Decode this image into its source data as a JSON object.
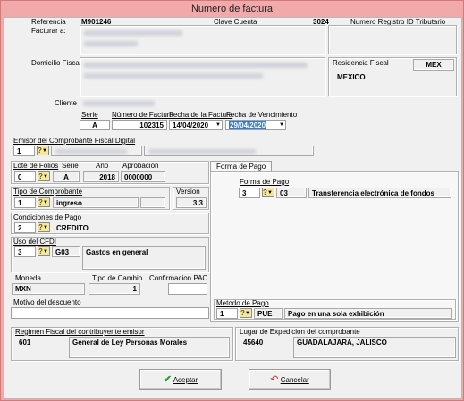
{
  "window": {
    "title": "Numero de factura"
  },
  "header": {
    "referencia_label": "Referencia",
    "referencia_value": "M901246",
    "clave_cuenta_label": "Clave Cuenta",
    "clave_cuenta_value": "3024",
    "numero_registro_label": "Numero Registro ID Tributario",
    "facturar_a_label": "Facturar a:",
    "domicilio_fiscal_label": "Domicilio Fiscal",
    "residencia_fiscal_label": "Residencia Fiscal",
    "residencia_code": "MEX",
    "residencia_name": "MEXICO",
    "cliente_label": "Cliente"
  },
  "invoice": {
    "serie_label": "Serie",
    "serie_value": "A",
    "numero_label": "Número de Factura",
    "numero_value": "102315",
    "fecha_label": "Fecha de la Factura",
    "fecha_value": "14/04/2020",
    "vencimiento_label": "Fecha de Vencimiento",
    "vencimiento_value": "29/04/2020"
  },
  "emisor": {
    "label": "Emisor del Comprobante Fiscal Digital",
    "value": "1"
  },
  "folios": {
    "lote_label": "Lote de Folios",
    "lote_value": "0",
    "serie_label": "Serie",
    "serie_value": "A",
    "anio_label": "Año",
    "anio_value": "2018",
    "aprobacion_label": "Aprobación",
    "aprobacion_value": "0000000"
  },
  "comprobante": {
    "tipo_label": "Tipo de Comprobante",
    "tipo_code": "1",
    "tipo_value": "ingreso",
    "version_label": "Version",
    "version_value": "3.3"
  },
  "condiciones": {
    "label": "Condiciones de Pago",
    "code": "2",
    "value": "CREDITO"
  },
  "cfdi": {
    "label": "Uso del CFDI",
    "code": "3",
    "clave": "G03",
    "value": "Gastos en general"
  },
  "moneda": {
    "label": "Moneda",
    "value": "MXN",
    "tipo_cambio_label": "Tipo de Cambio",
    "tipo_cambio_value": "1",
    "confirmacion_label": "Confirmacion PAC"
  },
  "motivo": {
    "label": "Motivo del descuento"
  },
  "forma_pago": {
    "tab_label": "Forma de Pago",
    "label": "Forma de Pago",
    "code": "3",
    "clave": "03",
    "value": "Transferencia electrónica de fondos"
  },
  "metodo_pago": {
    "label": "Metodo de Pago",
    "code": "1",
    "clave": "PUE",
    "value": "Pago en una sola exhibición"
  },
  "regimen": {
    "label": "Regimen Fiscal del contribuyente emisor",
    "code": "601",
    "value": "General de Ley Personas Morales"
  },
  "expedicion": {
    "label": "Lugar de Expedicion del comprobante",
    "code": "45640",
    "value": "GUADALAJARA, JALISCO"
  },
  "buttons": {
    "accept": "Aceptar",
    "cancel": "Cancelar"
  },
  "colors": {
    "title_bar": "#f2a9a9",
    "selection": "#3a78c8",
    "accept_check": "#2a9a2a",
    "cancel_icon": "#c83232"
  }
}
